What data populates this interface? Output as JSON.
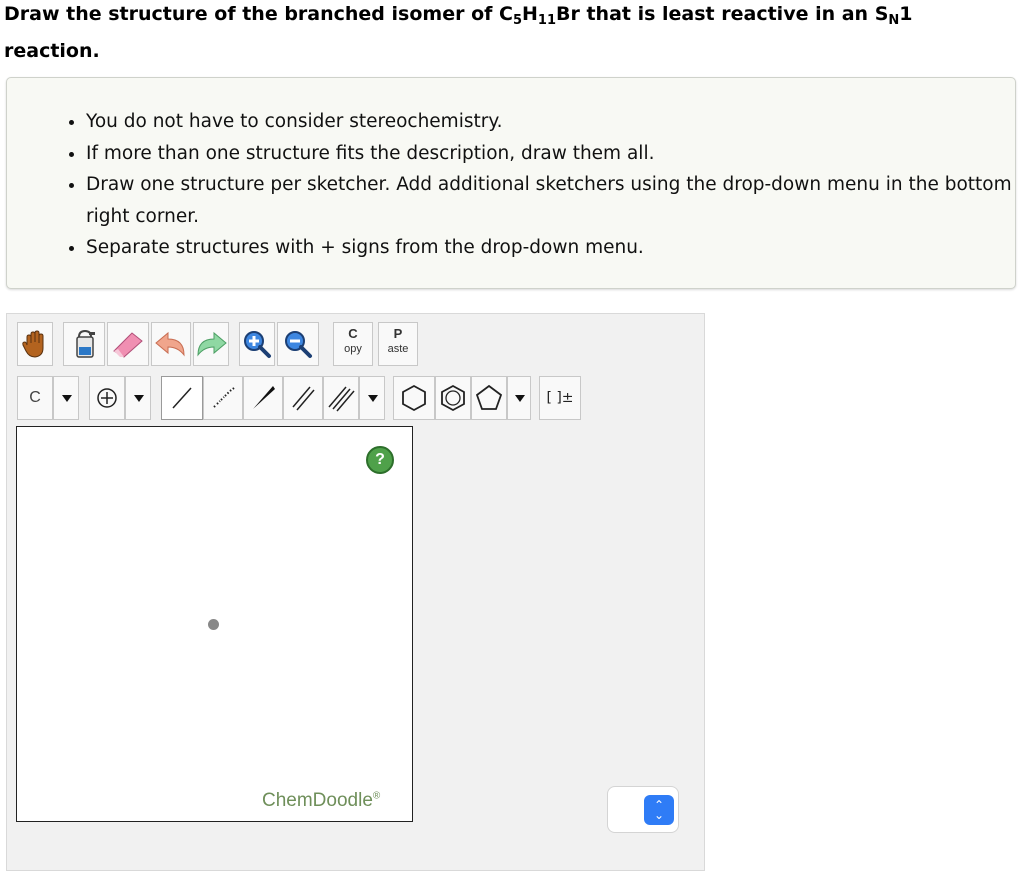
{
  "question": {
    "title_part1": "Draw the structure of the branched isomer of C",
    "sub_5": "5",
    "title_part2": "H",
    "sub_11": "11",
    "title_part3": "Br that is least reactive in an S",
    "sub_n": "N",
    "title_part4": "1 reaction."
  },
  "instructions": [
    "You do not have to consider stereochemistry.",
    "If more than one structure fits the description, draw them all.",
    "Draw one structure per sketcher. Add additional sketchers using the drop-down menu in the bottom right corner.",
    "Separate structures with + signs from the drop-down menu."
  ],
  "toolbar": {
    "copy_big": "C",
    "copy_small": "opy",
    "paste_big": "P",
    "paste_small": "aste",
    "element_label": "C",
    "charge_bracket_label": "[ ]±"
  },
  "canvas": {
    "help_label": "?",
    "brand": "ChemDoodle",
    "brand_reg": "®"
  },
  "icons": [
    "hand-icon",
    "clear-icon",
    "eraser-icon",
    "undo-icon",
    "redo-icon",
    "zoom-in-icon",
    "zoom-out-icon",
    "single-bond-icon",
    "recessed-bond-icon",
    "protruding-bond-icon",
    "double-bond-icon",
    "triple-bond-icon",
    "cyclohexane-icon",
    "benzene-icon",
    "cyclopentane-icon",
    "charge-icon",
    "help-icon",
    "chevron-updown-icon"
  ],
  "colors": {
    "help_green": "#4fa14a",
    "brand_green": "#6f8f5a",
    "select_blue": "#2f7cf6"
  }
}
